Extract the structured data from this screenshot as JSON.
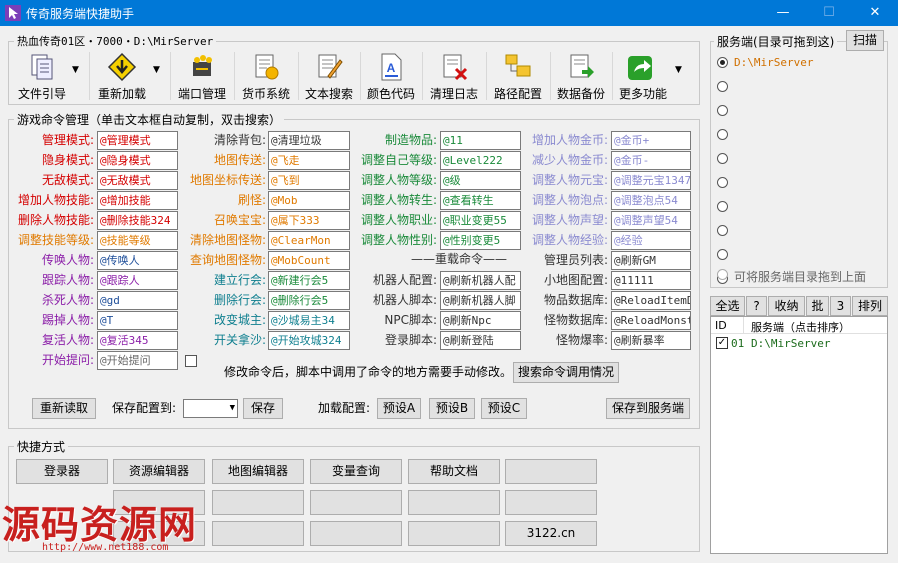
{
  "window": {
    "title": "传奇服务端快捷助手",
    "minimize": "—",
    "maximize": "☐",
    "close": "✕"
  },
  "server_info": "热血传奇01区・7000・D:\\MirServer",
  "toolbar": [
    {
      "label": "文件引导",
      "icon": "file-guide-icon"
    },
    {
      "label": "重新加载",
      "icon": "reload-icon"
    },
    {
      "label": "端口管理",
      "icon": "port-icon"
    },
    {
      "label": "货币系统",
      "icon": "currency-icon"
    },
    {
      "label": "文本搜索",
      "icon": "text-search-icon"
    },
    {
      "label": "颜色代码",
      "icon": "color-code-icon"
    },
    {
      "label": "清理日志",
      "icon": "clear-log-icon"
    },
    {
      "label": "路径配置",
      "icon": "path-config-icon"
    },
    {
      "label": "数据备份",
      "icon": "backup-icon"
    },
    {
      "label": "更多功能",
      "icon": "more-icon"
    }
  ],
  "commands": {
    "title": "游戏命令管理（单击文本框自动复制，双击搜索）",
    "col1": [
      {
        "label": "管理模式:",
        "value": "@管理模式"
      },
      {
        "label": "隐身模式:",
        "value": "@隐身模式"
      },
      {
        "label": "无敌模式:",
        "value": "@无敌模式"
      },
      {
        "label": "增加人物技能:",
        "value": "@增加技能"
      },
      {
        "label": "删除人物技能:",
        "value": "@删除技能324"
      },
      {
        "label": "调整技能等级:",
        "value": "@技能等级"
      },
      {
        "label": "传唤人物:",
        "value": "@传唤人"
      },
      {
        "label": "跟踪人物:",
        "value": "@跟踪人"
      },
      {
        "label": "杀死人物:",
        "value": "@gd"
      },
      {
        "label": "踢掉人物:",
        "value": "@T"
      },
      {
        "label": "复活人物:",
        "value": "@复活345"
      },
      {
        "label": "开始提问:",
        "value": "@开始提问"
      }
    ],
    "col2": [
      {
        "label": "清除背包:",
        "value": "@清理垃圾"
      },
      {
        "label": "地图传送:",
        "value": "@飞走"
      },
      {
        "label": "地图坐标传送:",
        "value": "@飞到"
      },
      {
        "label": "刷怪:",
        "value": "@Mob"
      },
      {
        "label": "召唤宝宝:",
        "value": "@属下333"
      },
      {
        "label": "清除地图怪物:",
        "value": "@ClearMon"
      },
      {
        "label": "查询地图怪物:",
        "value": "@MobCount"
      },
      {
        "label": "建立行会:",
        "value": "@新建行会5"
      },
      {
        "label": "删除行会:",
        "value": "@删除行会5"
      },
      {
        "label": "改变城主:",
        "value": "@沙城易主34"
      },
      {
        "label": "开关拿沙:",
        "value": "@开始攻城324"
      }
    ],
    "col3": [
      {
        "label": "制造物品:",
        "value": "@11"
      },
      {
        "label": "调整自己等级:",
        "value": "@Level222"
      },
      {
        "label": "调整人物等级:",
        "value": "@级"
      },
      {
        "label": "调整人物转生:",
        "value": "@查看转生"
      },
      {
        "label": "调整人物职业:",
        "value": "@职业变更55"
      },
      {
        "label": "调整人物性别:",
        "value": "@性别变更5"
      }
    ],
    "reload_header": "——重载命令——",
    "col3b": [
      {
        "label": "机器人配置:",
        "value": "@刷新机器人配"
      },
      {
        "label": "机器人脚本:",
        "value": "@刷新机器人脚"
      },
      {
        "label": "NPC脚本:",
        "value": "@刷新Npc"
      },
      {
        "label": "登录脚本:",
        "value": "@刷新登陆"
      }
    ],
    "col4": [
      {
        "label": "增加人物金币:",
        "value": "@金币+"
      },
      {
        "label": "减少人物金币:",
        "value": "@金币-"
      },
      {
        "label": "调整人物元宝:",
        "value": "@调整元宝1347"
      },
      {
        "label": "调整人物泡点:",
        "value": "@调整泡点54"
      },
      {
        "label": "调整人物声望:",
        "value": "@调整声望54"
      },
      {
        "label": "调整人物经验:",
        "value": "@经验"
      },
      {
        "label": "管理员列表:",
        "value": "@刷新GM"
      },
      {
        "label": "小地图配置:",
        "value": "@11111"
      },
      {
        "label": "物品数据库:",
        "value": "@ReloadItemDB"
      },
      {
        "label": "怪物数据库:",
        "value": "@ReloadMonste"
      },
      {
        "label": "怪物爆率:",
        "value": "@刷新暴率"
      }
    ],
    "notice": "修改命令后，脚本中调用了命令的地方需要手动修改。",
    "search_usage": "搜索命令调用情况",
    "reread": "重新读取",
    "save_to_label": "保存配置到:",
    "save": "保存",
    "load_label": "加载配置:",
    "preset_a": "预设A",
    "preset_b": "预设B",
    "preset_c": "预设C",
    "save_server": "保存到服务端"
  },
  "shortcuts": {
    "title": "快捷方式",
    "row1": [
      "登录器",
      "资源编辑器",
      "地图编辑器",
      "变量查询",
      "帮助文档",
      ""
    ],
    "row2": [
      "",
      "",
      "",
      "",
      "",
      ""
    ],
    "row3": [
      "",
      "",
      "",
      "",
      "",
      "3122.cn"
    ]
  },
  "watermark": {
    "main": "源码资源网",
    "url": "http://www.net188.com"
  },
  "server_panel": {
    "title": "服务端(目录可拖到这)",
    "scan": "扫描",
    "radios": [
      "D:\\MirServer",
      "",
      "",
      "",
      "",
      "",
      "",
      "",
      "",
      ""
    ],
    "hint": "可将服务端目录拖到上面",
    "buttons": [
      "全选",
      "?",
      "收纳",
      "批",
      "3",
      "排列"
    ],
    "columns": [
      "ID",
      "服务端（点击排序）"
    ],
    "rows": [
      {
        "id": "01",
        "path": "D:\\MirServer",
        "checked": true
      }
    ]
  }
}
